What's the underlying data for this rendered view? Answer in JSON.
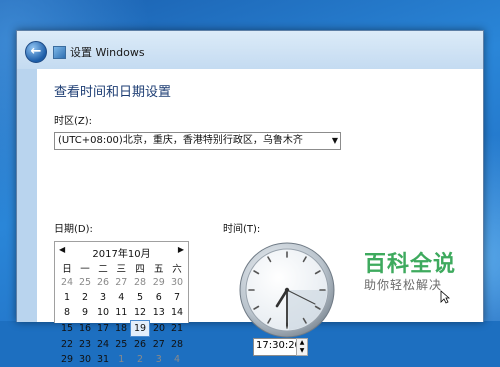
{
  "window": {
    "title": "设置 Windows"
  },
  "heading": "查看时间和日期设置",
  "timezone": {
    "label": "时区(Z):",
    "value": "(UTC+08:00)北京，重庆，香港特别行政区，乌鲁木齐"
  },
  "date": {
    "label": "日期(D):",
    "month_label": "2017年10月",
    "weekdays": [
      "日",
      "一",
      "二",
      "三",
      "四",
      "五",
      "六"
    ],
    "weeks": [
      [
        "24",
        "25",
        "26",
        "27",
        "28",
        "29",
        "30"
      ],
      [
        "1",
        "2",
        "3",
        "4",
        "5",
        "6",
        "7"
      ],
      [
        "8",
        "9",
        "10",
        "11",
        "12",
        "13",
        "14"
      ],
      [
        "15",
        "16",
        "17",
        "18",
        "19",
        "20",
        "21"
      ],
      [
        "22",
        "23",
        "24",
        "25",
        "26",
        "27",
        "28"
      ],
      [
        "29",
        "30",
        "31",
        "1",
        "2",
        "3",
        "4"
      ]
    ],
    "selected_day": "19"
  },
  "time": {
    "label": "时间(T):",
    "value": "17:30:20"
  },
  "watermark": {
    "title": "百科全说",
    "subtitle": "助你轻松解决"
  },
  "colors": {
    "heading": "#1e3e74",
    "watermark_green": "#3eaa5e",
    "selection": "#4a8ad0"
  }
}
